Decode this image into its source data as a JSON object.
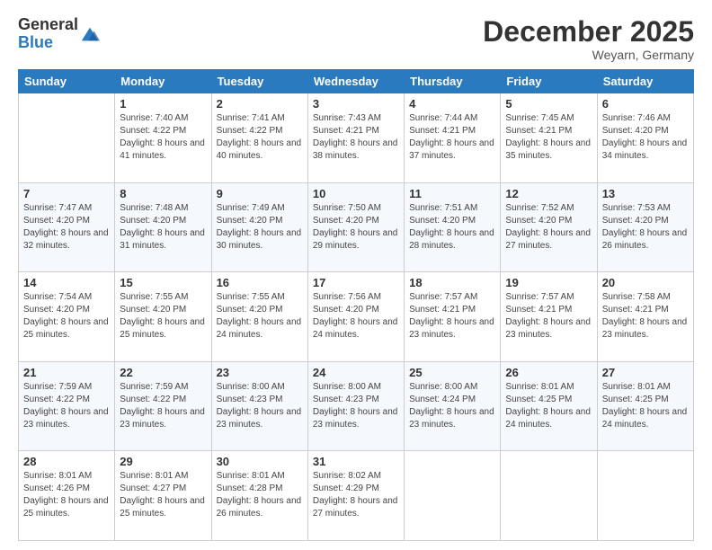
{
  "logo": {
    "general": "General",
    "blue": "Blue"
  },
  "header": {
    "month": "December 2025",
    "location": "Weyarn, Germany"
  },
  "days": {
    "headers": [
      "Sunday",
      "Monday",
      "Tuesday",
      "Wednesday",
      "Thursday",
      "Friday",
      "Saturday"
    ]
  },
  "weeks": [
    {
      "cells": [
        {
          "day": "",
          "sunrise": "",
          "sunset": "",
          "daylight": ""
        },
        {
          "day": "1",
          "sunrise": "Sunrise: 7:40 AM",
          "sunset": "Sunset: 4:22 PM",
          "daylight": "Daylight: 8 hours and 41 minutes."
        },
        {
          "day": "2",
          "sunrise": "Sunrise: 7:41 AM",
          "sunset": "Sunset: 4:22 PM",
          "daylight": "Daylight: 8 hours and 40 minutes."
        },
        {
          "day": "3",
          "sunrise": "Sunrise: 7:43 AM",
          "sunset": "Sunset: 4:21 PM",
          "daylight": "Daylight: 8 hours and 38 minutes."
        },
        {
          "day": "4",
          "sunrise": "Sunrise: 7:44 AM",
          "sunset": "Sunset: 4:21 PM",
          "daylight": "Daylight: 8 hours and 37 minutes."
        },
        {
          "day": "5",
          "sunrise": "Sunrise: 7:45 AM",
          "sunset": "Sunset: 4:21 PM",
          "daylight": "Daylight: 8 hours and 35 minutes."
        },
        {
          "day": "6",
          "sunrise": "Sunrise: 7:46 AM",
          "sunset": "Sunset: 4:20 PM",
          "daylight": "Daylight: 8 hours and 34 minutes."
        }
      ]
    },
    {
      "cells": [
        {
          "day": "7",
          "sunrise": "Sunrise: 7:47 AM",
          "sunset": "Sunset: 4:20 PM",
          "daylight": "Daylight: 8 hours and 32 minutes."
        },
        {
          "day": "8",
          "sunrise": "Sunrise: 7:48 AM",
          "sunset": "Sunset: 4:20 PM",
          "daylight": "Daylight: 8 hours and 31 minutes."
        },
        {
          "day": "9",
          "sunrise": "Sunrise: 7:49 AM",
          "sunset": "Sunset: 4:20 PM",
          "daylight": "Daylight: 8 hours and 30 minutes."
        },
        {
          "day": "10",
          "sunrise": "Sunrise: 7:50 AM",
          "sunset": "Sunset: 4:20 PM",
          "daylight": "Daylight: 8 hours and 29 minutes."
        },
        {
          "day": "11",
          "sunrise": "Sunrise: 7:51 AM",
          "sunset": "Sunset: 4:20 PM",
          "daylight": "Daylight: 8 hours and 28 minutes."
        },
        {
          "day": "12",
          "sunrise": "Sunrise: 7:52 AM",
          "sunset": "Sunset: 4:20 PM",
          "daylight": "Daylight: 8 hours and 27 minutes."
        },
        {
          "day": "13",
          "sunrise": "Sunrise: 7:53 AM",
          "sunset": "Sunset: 4:20 PM",
          "daylight": "Daylight: 8 hours and 26 minutes."
        }
      ]
    },
    {
      "cells": [
        {
          "day": "14",
          "sunrise": "Sunrise: 7:54 AM",
          "sunset": "Sunset: 4:20 PM",
          "daylight": "Daylight: 8 hours and 25 minutes."
        },
        {
          "day": "15",
          "sunrise": "Sunrise: 7:55 AM",
          "sunset": "Sunset: 4:20 PM",
          "daylight": "Daylight: 8 hours and 25 minutes."
        },
        {
          "day": "16",
          "sunrise": "Sunrise: 7:55 AM",
          "sunset": "Sunset: 4:20 PM",
          "daylight": "Daylight: 8 hours and 24 minutes."
        },
        {
          "day": "17",
          "sunrise": "Sunrise: 7:56 AM",
          "sunset": "Sunset: 4:20 PM",
          "daylight": "Daylight: 8 hours and 24 minutes."
        },
        {
          "day": "18",
          "sunrise": "Sunrise: 7:57 AM",
          "sunset": "Sunset: 4:21 PM",
          "daylight": "Daylight: 8 hours and 23 minutes."
        },
        {
          "day": "19",
          "sunrise": "Sunrise: 7:57 AM",
          "sunset": "Sunset: 4:21 PM",
          "daylight": "Daylight: 8 hours and 23 minutes."
        },
        {
          "day": "20",
          "sunrise": "Sunrise: 7:58 AM",
          "sunset": "Sunset: 4:21 PM",
          "daylight": "Daylight: 8 hours and 23 minutes."
        }
      ]
    },
    {
      "cells": [
        {
          "day": "21",
          "sunrise": "Sunrise: 7:59 AM",
          "sunset": "Sunset: 4:22 PM",
          "daylight": "Daylight: 8 hours and 23 minutes."
        },
        {
          "day": "22",
          "sunrise": "Sunrise: 7:59 AM",
          "sunset": "Sunset: 4:22 PM",
          "daylight": "Daylight: 8 hours and 23 minutes."
        },
        {
          "day": "23",
          "sunrise": "Sunrise: 8:00 AM",
          "sunset": "Sunset: 4:23 PM",
          "daylight": "Daylight: 8 hours and 23 minutes."
        },
        {
          "day": "24",
          "sunrise": "Sunrise: 8:00 AM",
          "sunset": "Sunset: 4:23 PM",
          "daylight": "Daylight: 8 hours and 23 minutes."
        },
        {
          "day": "25",
          "sunrise": "Sunrise: 8:00 AM",
          "sunset": "Sunset: 4:24 PM",
          "daylight": "Daylight: 8 hours and 23 minutes."
        },
        {
          "day": "26",
          "sunrise": "Sunrise: 8:01 AM",
          "sunset": "Sunset: 4:25 PM",
          "daylight": "Daylight: 8 hours and 24 minutes."
        },
        {
          "day": "27",
          "sunrise": "Sunrise: 8:01 AM",
          "sunset": "Sunset: 4:25 PM",
          "daylight": "Daylight: 8 hours and 24 minutes."
        }
      ]
    },
    {
      "cells": [
        {
          "day": "28",
          "sunrise": "Sunrise: 8:01 AM",
          "sunset": "Sunset: 4:26 PM",
          "daylight": "Daylight: 8 hours and 25 minutes."
        },
        {
          "day": "29",
          "sunrise": "Sunrise: 8:01 AM",
          "sunset": "Sunset: 4:27 PM",
          "daylight": "Daylight: 8 hours and 25 minutes."
        },
        {
          "day": "30",
          "sunrise": "Sunrise: 8:01 AM",
          "sunset": "Sunset: 4:28 PM",
          "daylight": "Daylight: 8 hours and 26 minutes."
        },
        {
          "day": "31",
          "sunrise": "Sunrise: 8:02 AM",
          "sunset": "Sunset: 4:29 PM",
          "daylight": "Daylight: 8 hours and 27 minutes."
        },
        {
          "day": "",
          "sunrise": "",
          "sunset": "",
          "daylight": ""
        },
        {
          "day": "",
          "sunrise": "",
          "sunset": "",
          "daylight": ""
        },
        {
          "day": "",
          "sunrise": "",
          "sunset": "",
          "daylight": ""
        }
      ]
    }
  ]
}
